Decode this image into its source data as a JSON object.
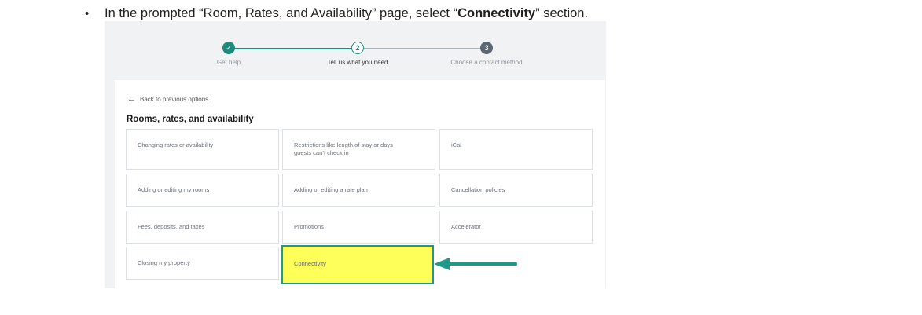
{
  "instruction": {
    "bullet": "•",
    "prefix": "In the prompted “Room, Rates, and Availability” page, select “",
    "bold": "Connectivity",
    "suffix": "” section."
  },
  "stepper": {
    "steps": [
      {
        "number": "✓",
        "label": "Get help",
        "state": "done"
      },
      {
        "number": "2",
        "label": "Tell us what you need",
        "state": "current"
      },
      {
        "number": "3",
        "label": "Choose a contact method",
        "state": "todo"
      }
    ]
  },
  "panel": {
    "back_label": "Back to previous options",
    "back_icon": "arrow-left-icon",
    "title": "Rooms, rates, and availability",
    "options": [
      {
        "label": "Changing rates or availability"
      },
      {
        "label": "Restrictions like length of stay or days guests can’t check in"
      },
      {
        "label": "iCal"
      },
      {
        "label": "Adding or editing my rooms"
      },
      {
        "label": "Adding or editing a rate plan"
      },
      {
        "label": "Cancellation policies"
      },
      {
        "label": "Fees, deposits, and taxes"
      },
      {
        "label": "Promotions"
      },
      {
        "label": "Accelerator"
      },
      {
        "label": "Closing my property"
      },
      {
        "label": "Connectivity",
        "highlighted": true
      }
    ]
  },
  "colors": {
    "accent": "#1e8a7a",
    "highlight": "#ffff5a",
    "pointer_arrow": "#1f9a8a"
  }
}
